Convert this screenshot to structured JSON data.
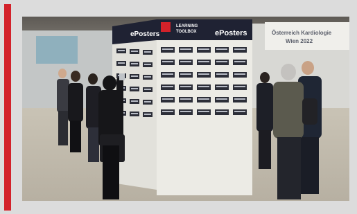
{
  "colors": {
    "accent": "#d3222a",
    "frame_background": "#dcdcdc",
    "pillar_header": "#1f2233",
    "pillar_body": "#ecebe5"
  },
  "signage": {
    "left_brand": "ePosters",
    "center_brand_line1": "LEARNING",
    "center_brand_line2": "TOOLBOX",
    "right_brand": "ePosters"
  },
  "background_banner": {
    "line1": "Österreich Kardiologie",
    "line2": "Wien 2022"
  }
}
